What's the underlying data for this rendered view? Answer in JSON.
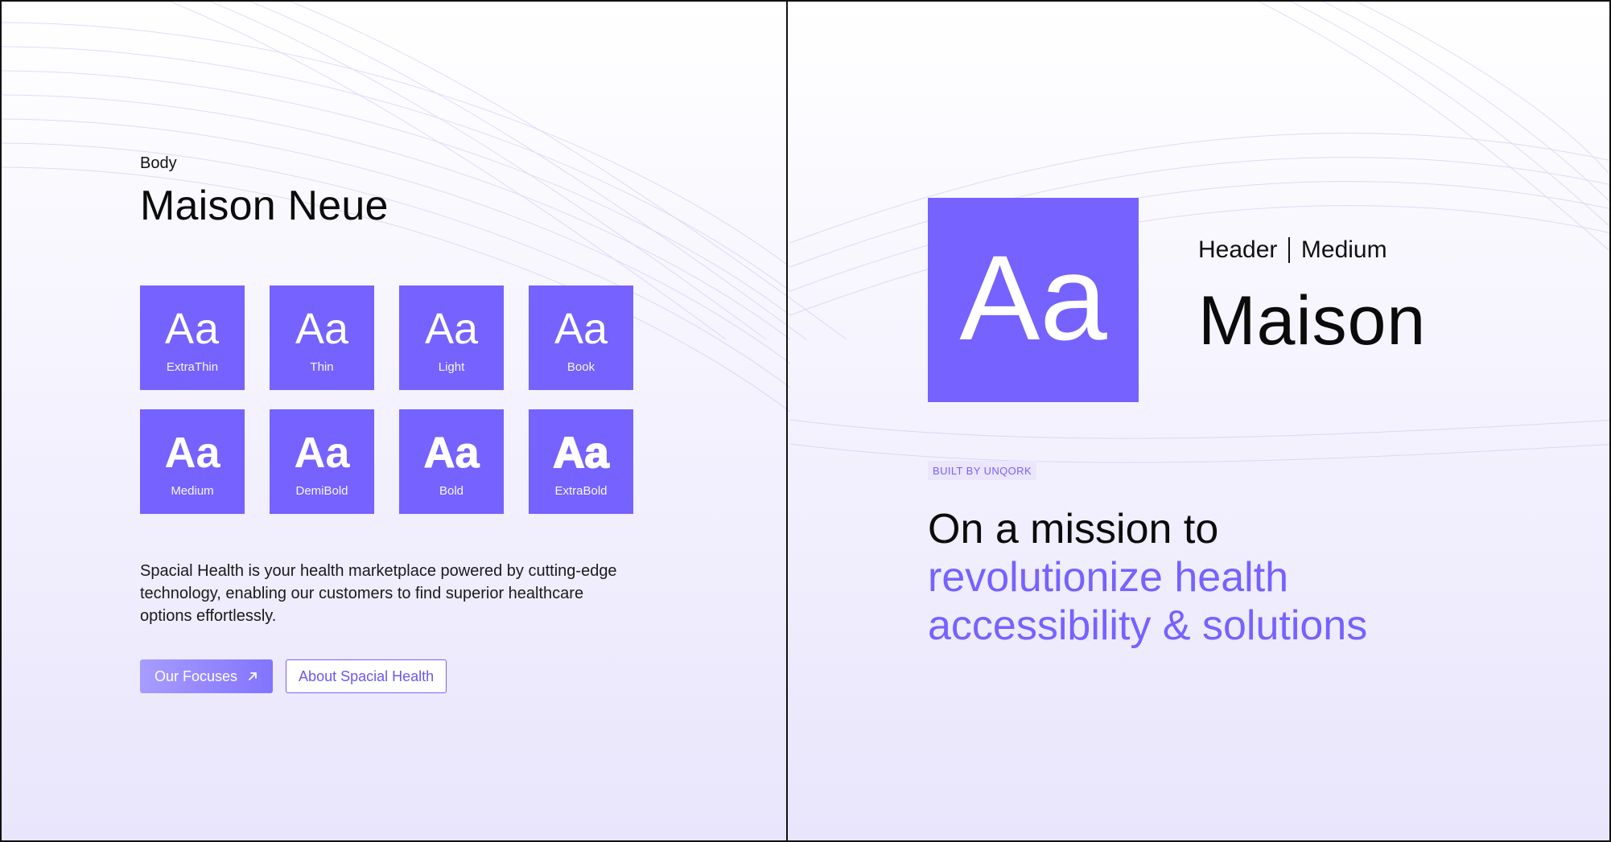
{
  "left": {
    "label": "Body",
    "font_name": "Maison Neue",
    "weights": [
      {
        "glyph": "Aa",
        "name": "ExtraThin",
        "weight": 100
      },
      {
        "glyph": "Aa",
        "name": "Thin",
        "weight": 200
      },
      {
        "glyph": "Aa",
        "name": "Light",
        "weight": 300
      },
      {
        "glyph": "Aa",
        "name": "Book",
        "weight": 400
      },
      {
        "glyph": "Aa",
        "name": "Medium",
        "weight": 600
      },
      {
        "glyph": "Aa",
        "name": "DemiBold",
        "weight": 700
      },
      {
        "glyph": "Aa",
        "name": "Bold",
        "weight": 800
      },
      {
        "glyph": "Aa",
        "name": "ExtraBold",
        "weight": 900
      }
    ],
    "description": "Spacial Health is your health marketplace powered by cutting-edge technology, enabling our customers to find superior healthcare options effortlessly.",
    "primary_button": {
      "label": "Our Focuses",
      "icon": "arrow-up-right-icon"
    },
    "secondary_button": {
      "label": "About Spacial Health"
    }
  },
  "right": {
    "sample_glyph": "Aa",
    "style_label": "Header",
    "weight_label": "Medium",
    "font_name": "Maison",
    "badge": "BUILT BY UNQORK",
    "headline": {
      "line1": "On a mission to",
      "line2": "revolutionize health",
      "line3": "accessibility & solutions"
    }
  },
  "colors": {
    "accent": "#7562ff",
    "text": "#111111",
    "badge_bg": "#ebe6fc",
    "background_bottom": "#e9e5fc"
  }
}
